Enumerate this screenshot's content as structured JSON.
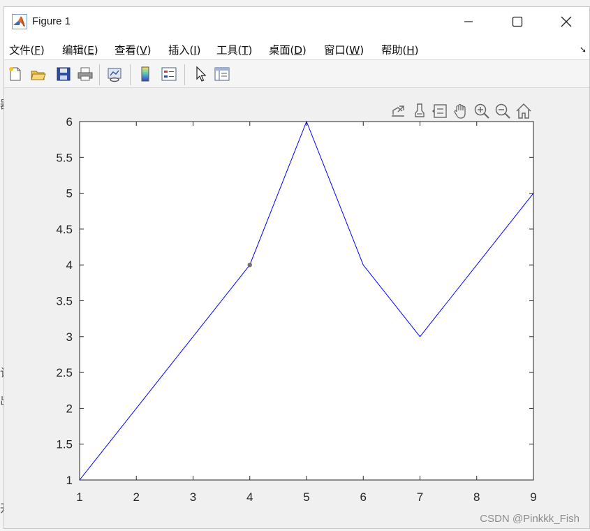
{
  "window": {
    "title": "Figure 1",
    "minimize_icon": "minimize-icon",
    "maximize_icon": "maximize-icon",
    "close_icon": "close-icon"
  },
  "menu": {
    "items": [
      {
        "label": "文件",
        "key": "F"
      },
      {
        "label": "编辑",
        "key": "E"
      },
      {
        "label": "查看",
        "key": "V"
      },
      {
        "label": "插入",
        "key": "I"
      },
      {
        "label": "工具",
        "key": "T"
      },
      {
        "label": "桌面",
        "key": "D"
      },
      {
        "label": "窗口",
        "key": "W"
      },
      {
        "label": "帮助",
        "key": "H"
      }
    ],
    "overflow_icon": "dock-arrow-icon"
  },
  "toolbar": {
    "buttons": [
      "new-figure-icon",
      "open-file-icon",
      "save-icon",
      "print-icon",
      "link-plot-icon",
      "colorbar-icon",
      "legend-icon",
      "edit-plot-icon",
      "property-inspector-icon"
    ]
  },
  "axes_toolbar": {
    "buttons": [
      "export-icon",
      "brush-icon",
      "data-tips-icon",
      "pan-icon",
      "zoom-in-icon",
      "zoom-out-icon",
      "home-icon"
    ]
  },
  "chart_data": {
    "type": "line",
    "x": [
      1,
      2,
      3,
      4,
      5,
      6,
      7,
      8,
      9
    ],
    "series": [
      {
        "values": [
          1,
          2,
          3,
          4,
          6,
          4,
          3,
          4,
          5
        ],
        "color": "#0000ff"
      }
    ],
    "highlight_point": {
      "x": 4,
      "y": 4,
      "color": "#707070"
    },
    "xlim": [
      1,
      9
    ],
    "ylim": [
      1,
      6
    ],
    "xticks": [
      1,
      2,
      3,
      4,
      5,
      6,
      7,
      8,
      9
    ],
    "yticks": [
      1,
      1.5,
      2,
      2.5,
      3,
      3.5,
      4,
      4.5,
      5,
      5.5,
      6
    ],
    "grid": false
  },
  "watermark": "CSDN @Pinkkk_Fish",
  "colors": {
    "line": "#0000ff",
    "axes": "#262626",
    "figure_bg": "#f0f0f0",
    "plot_bg": "#ffffff"
  }
}
